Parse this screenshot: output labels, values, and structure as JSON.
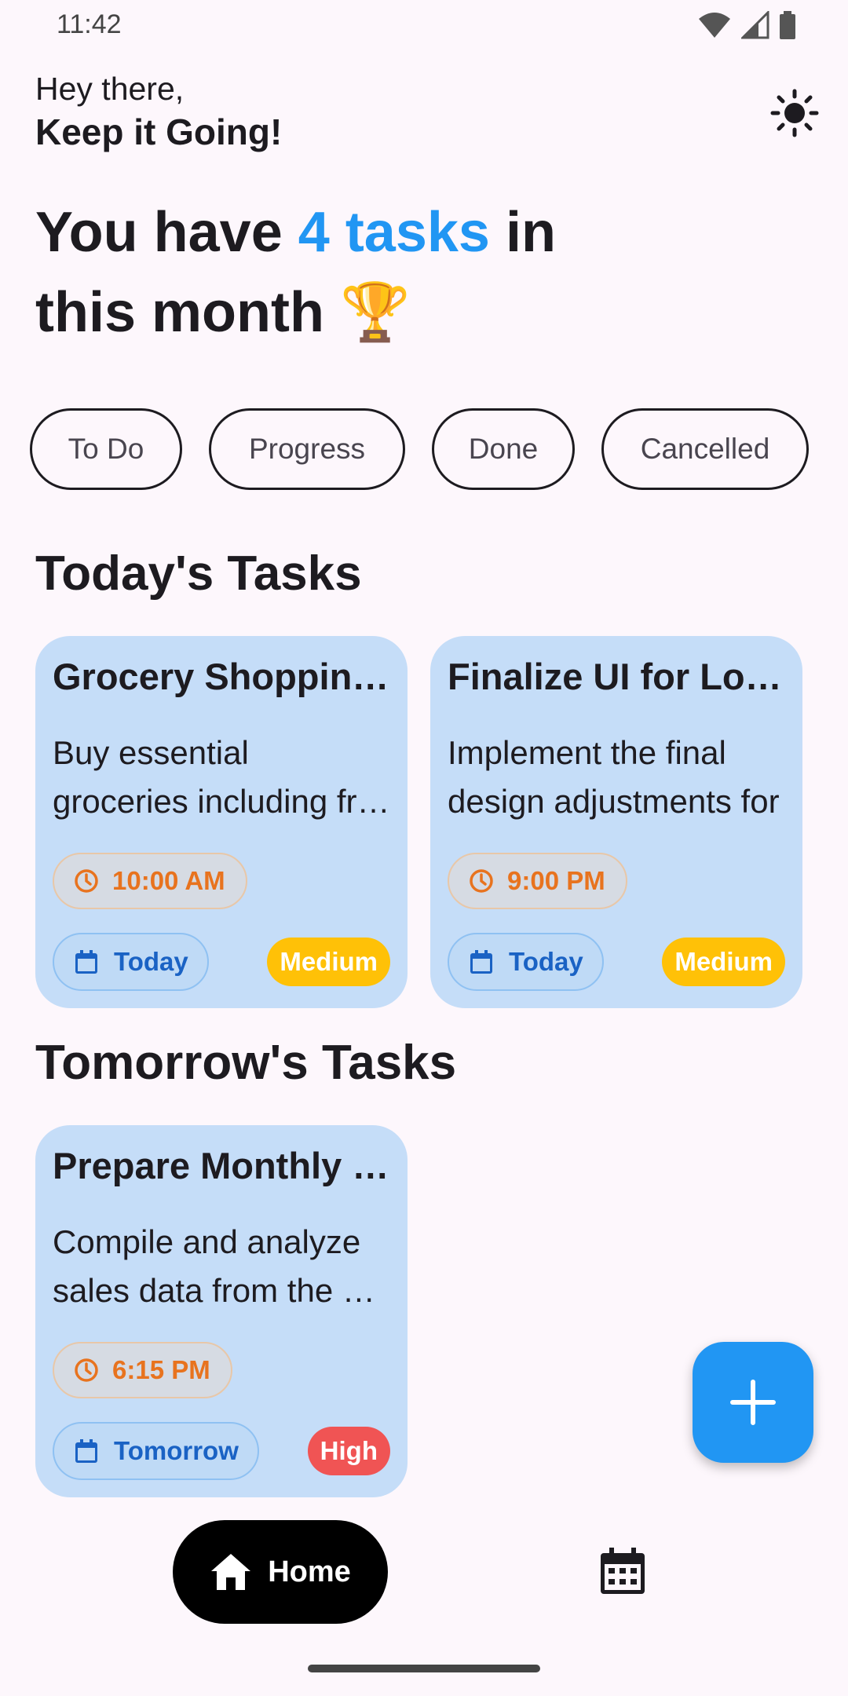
{
  "status_bar": {
    "time": "11:42"
  },
  "greeting": {
    "line1": "Hey there,",
    "line2": "Keep it Going!"
  },
  "headline": {
    "prefix": "You have ",
    "accent": "4 tasks",
    "suffix_line1": " in",
    "line2": "this month",
    "emoji": "🏆"
  },
  "filters": [
    "To Do",
    "Progress",
    "Done",
    "Cancelled"
  ],
  "sections": {
    "today": {
      "title": "Today's Tasks",
      "tasks": [
        {
          "title": "Grocery Shopping for the Week",
          "desc_line1": "Buy essential",
          "desc_line2": "groceries including fruits",
          "time": "10:00 AM",
          "date": "Today",
          "priority": "Medium"
        },
        {
          "title": "Finalize UI for Login Screen",
          "desc_line1": "Implement the final",
          "desc_line2": "design adjustments for",
          "time": "9:00 PM",
          "date": "Today",
          "priority": "Medium"
        }
      ]
    },
    "tomorrow": {
      "title": "Tomorrow's Tasks",
      "tasks": [
        {
          "title": "Prepare Monthly Report",
          "desc_line1": "Compile and analyze",
          "desc_line2": "sales data from the month",
          "time": "6:15 PM",
          "date": "Tomorrow",
          "priority": "High"
        }
      ]
    }
  },
  "colors": {
    "accent": "#2196f3",
    "card_bg": "#c5ddf8",
    "medium": "#ffc107",
    "high": "#f05454",
    "time_text": "#e8731e",
    "date_text": "#1a62c4"
  },
  "nav": {
    "home_label": "Home",
    "icons": [
      "home-icon",
      "calendar-icon"
    ]
  },
  "fab": {
    "icon": "plus-icon"
  }
}
